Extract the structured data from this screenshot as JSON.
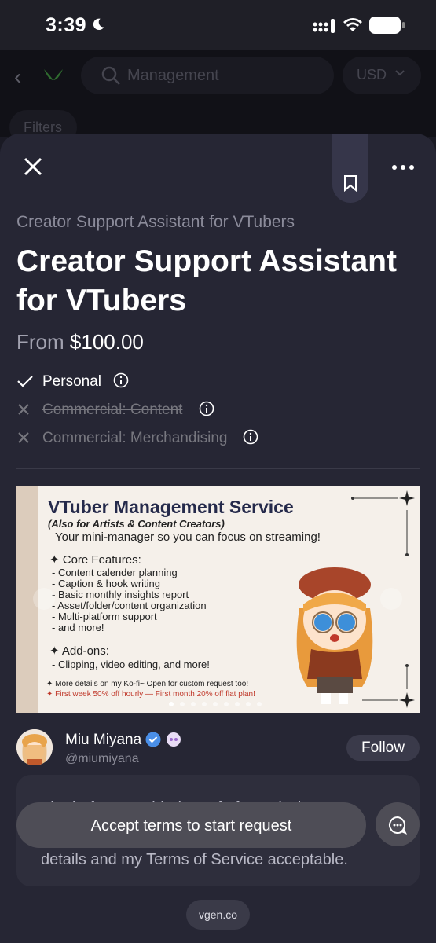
{
  "status_bar": {
    "time": "3:39"
  },
  "background": {
    "search_placeholder": "Management",
    "currency": "USD",
    "filters_label": "Filters"
  },
  "service": {
    "category": "Creator Support Assistant for VTubers",
    "title": "Creator Support Assistant for VTubers",
    "price_prefix": "From",
    "price": "$100.00",
    "licenses": [
      {
        "label": "Personal",
        "available": true
      },
      {
        "label": "Commercial: Content",
        "available": false
      },
      {
        "label": "Commercial: Merchandising",
        "available": false
      }
    ]
  },
  "banner": {
    "title": "VTuber Management Service",
    "subtitle": "(Also for Artists & Content Creators)",
    "tagline": "Your mini-manager so you can focus on streaming!",
    "core_heading": "✦ Core Features:",
    "core_items": [
      "- Content calender planning",
      "- Caption & hook writing",
      "- Basic monthly insights report",
      "- Asset/folder/content organization",
      "- Multi-platform support",
      "- and more!"
    ],
    "addons_heading": "✦ Add-ons:",
    "addons_text": "- Clipping, video editing, and more!",
    "note1": "✦ More details on my Ko-fi~ Open for custom request too!",
    "note2": "✦ First week 50% off hourly — First month 20% off flat plan!",
    "carousel_dots": 9,
    "active_dot": 0
  },
  "creator": {
    "name": "Miu Miyana",
    "handle": "@miumiyana",
    "follow_label": "Follow"
  },
  "description_visible": "The before provided proof of ... commission ... details and my Terms of Service acceptable.",
  "description": {
    "line1": "The before provided proof of ommission",
    "line2": "",
    "line3": "details and my Terms of Service acceptable."
  },
  "cta": {
    "label": "Accept terms to start request"
  },
  "footer": {
    "url": "vgen.co"
  },
  "colors": {
    "sheet": "#262634",
    "accent_check": "#ffffff",
    "verified": "#4a8fe8"
  }
}
